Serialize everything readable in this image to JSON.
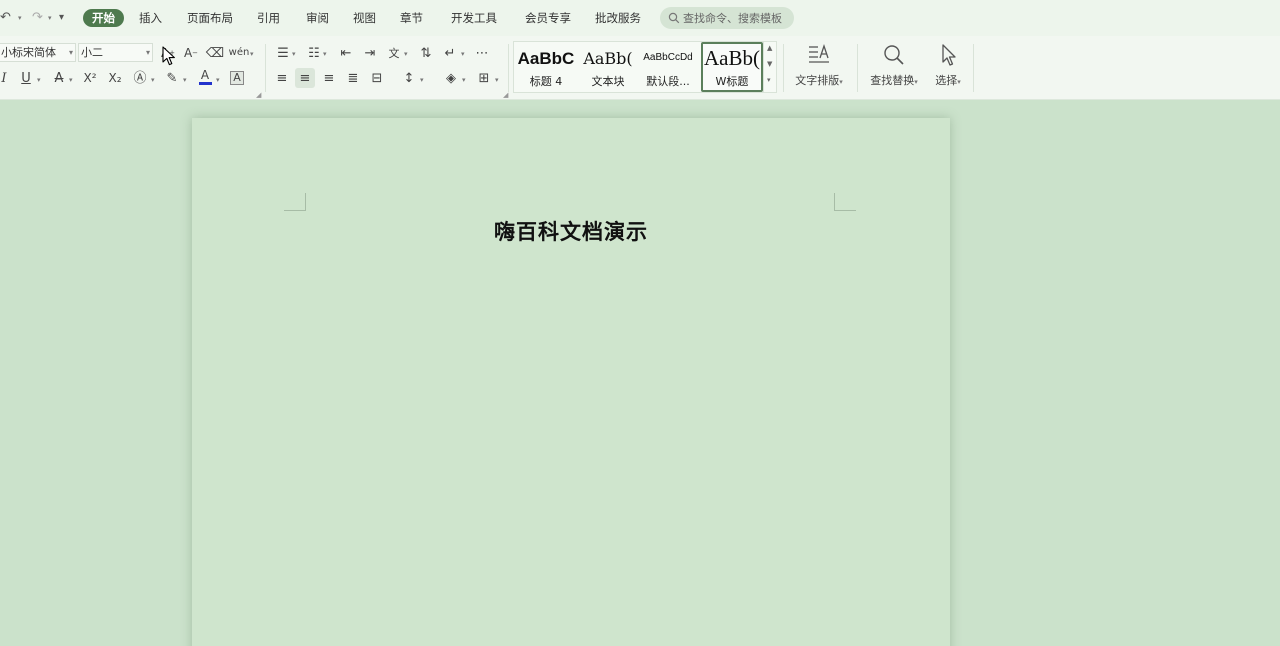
{
  "menubar": {
    "tabs": [
      {
        "label": "开始",
        "active": true
      },
      {
        "label": "插入"
      },
      {
        "label": "页面布局"
      },
      {
        "label": "引用"
      },
      {
        "label": "审阅"
      },
      {
        "label": "视图"
      },
      {
        "label": "章节"
      },
      {
        "label": "开发工具"
      },
      {
        "label": "会员专享"
      },
      {
        "label": "批改服务"
      }
    ],
    "search_placeholder": "查找命令、搜索模板"
  },
  "ribbon": {
    "font_name": "小标宋简体",
    "font_size": "小二",
    "styles": [
      {
        "sample": "AaBbC",
        "name": "标题 4"
      },
      {
        "sample": "AaBb(",
        "name": "文本块"
      },
      {
        "sample": "AaBbCcDd",
        "name": "默认段..."
      },
      {
        "sample": "AaBb(",
        "name": "W标题",
        "selected": true
      }
    ],
    "text_layout_label": "文字排版",
    "find_replace_label": "查找替换",
    "select_label": "选择"
  },
  "document": {
    "title": "嗨百科文档演示"
  },
  "colors": {
    "accent": "#4e7a4e",
    "background": "#cbe2cb",
    "font_color_bar": "#2233cc"
  }
}
